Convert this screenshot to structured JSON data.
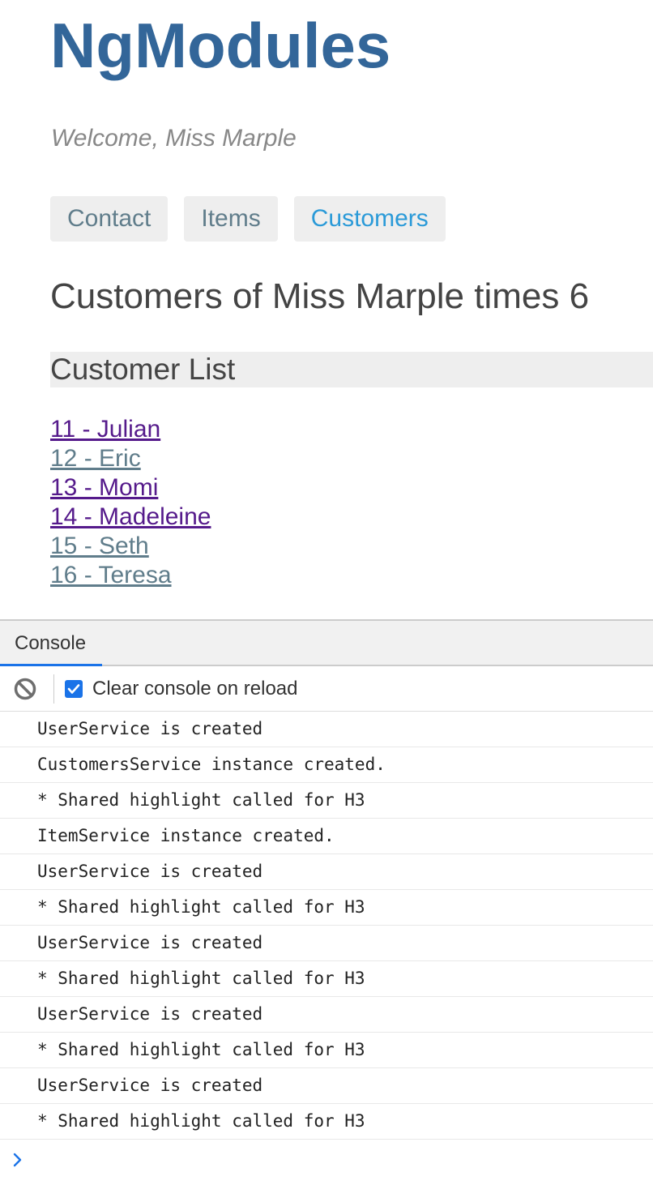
{
  "app": {
    "title": "NgModules",
    "welcome": "Welcome, Miss Marple",
    "nav": [
      {
        "label": "Contact",
        "active": false
      },
      {
        "label": "Items",
        "active": false
      },
      {
        "label": "Customers",
        "active": true
      }
    ],
    "heading": "Customers of Miss Marple times 6",
    "list_heading": "Customer List",
    "customers": [
      {
        "label": "11 - Julian",
        "visited": true
      },
      {
        "label": "12 - Eric",
        "visited": false
      },
      {
        "label": "13 - Momi",
        "visited": true
      },
      {
        "label": "14 - Madeleine",
        "visited": true
      },
      {
        "label": "15 - Seth",
        "visited": false
      },
      {
        "label": "16 - Teresa",
        "visited": false
      }
    ]
  },
  "console": {
    "tab_label": "Console",
    "clear_icon": "block-icon",
    "clear_on_reload_label": "Clear console on reload",
    "clear_on_reload_checked": true,
    "messages": [
      "UserService is created",
      "CustomersService instance created.",
      "* Shared highlight called for H3",
      "ItemService instance created.",
      "UserService is created",
      "* Shared highlight called for H3",
      "UserService is created",
      "* Shared highlight called for H3",
      "UserService is created",
      "* Shared highlight called for H3",
      "UserService is created",
      "* Shared highlight called for H3"
    ],
    "prompt_icon": "chevron-right-icon"
  },
  "colors": {
    "title": "#336699",
    "nav_active": "#2a9ad8",
    "nav_inactive": "#607d8b",
    "link_visited": "#551a8b",
    "link_unvisited": "#607d8b",
    "devtools_accent": "#1a73e8"
  }
}
